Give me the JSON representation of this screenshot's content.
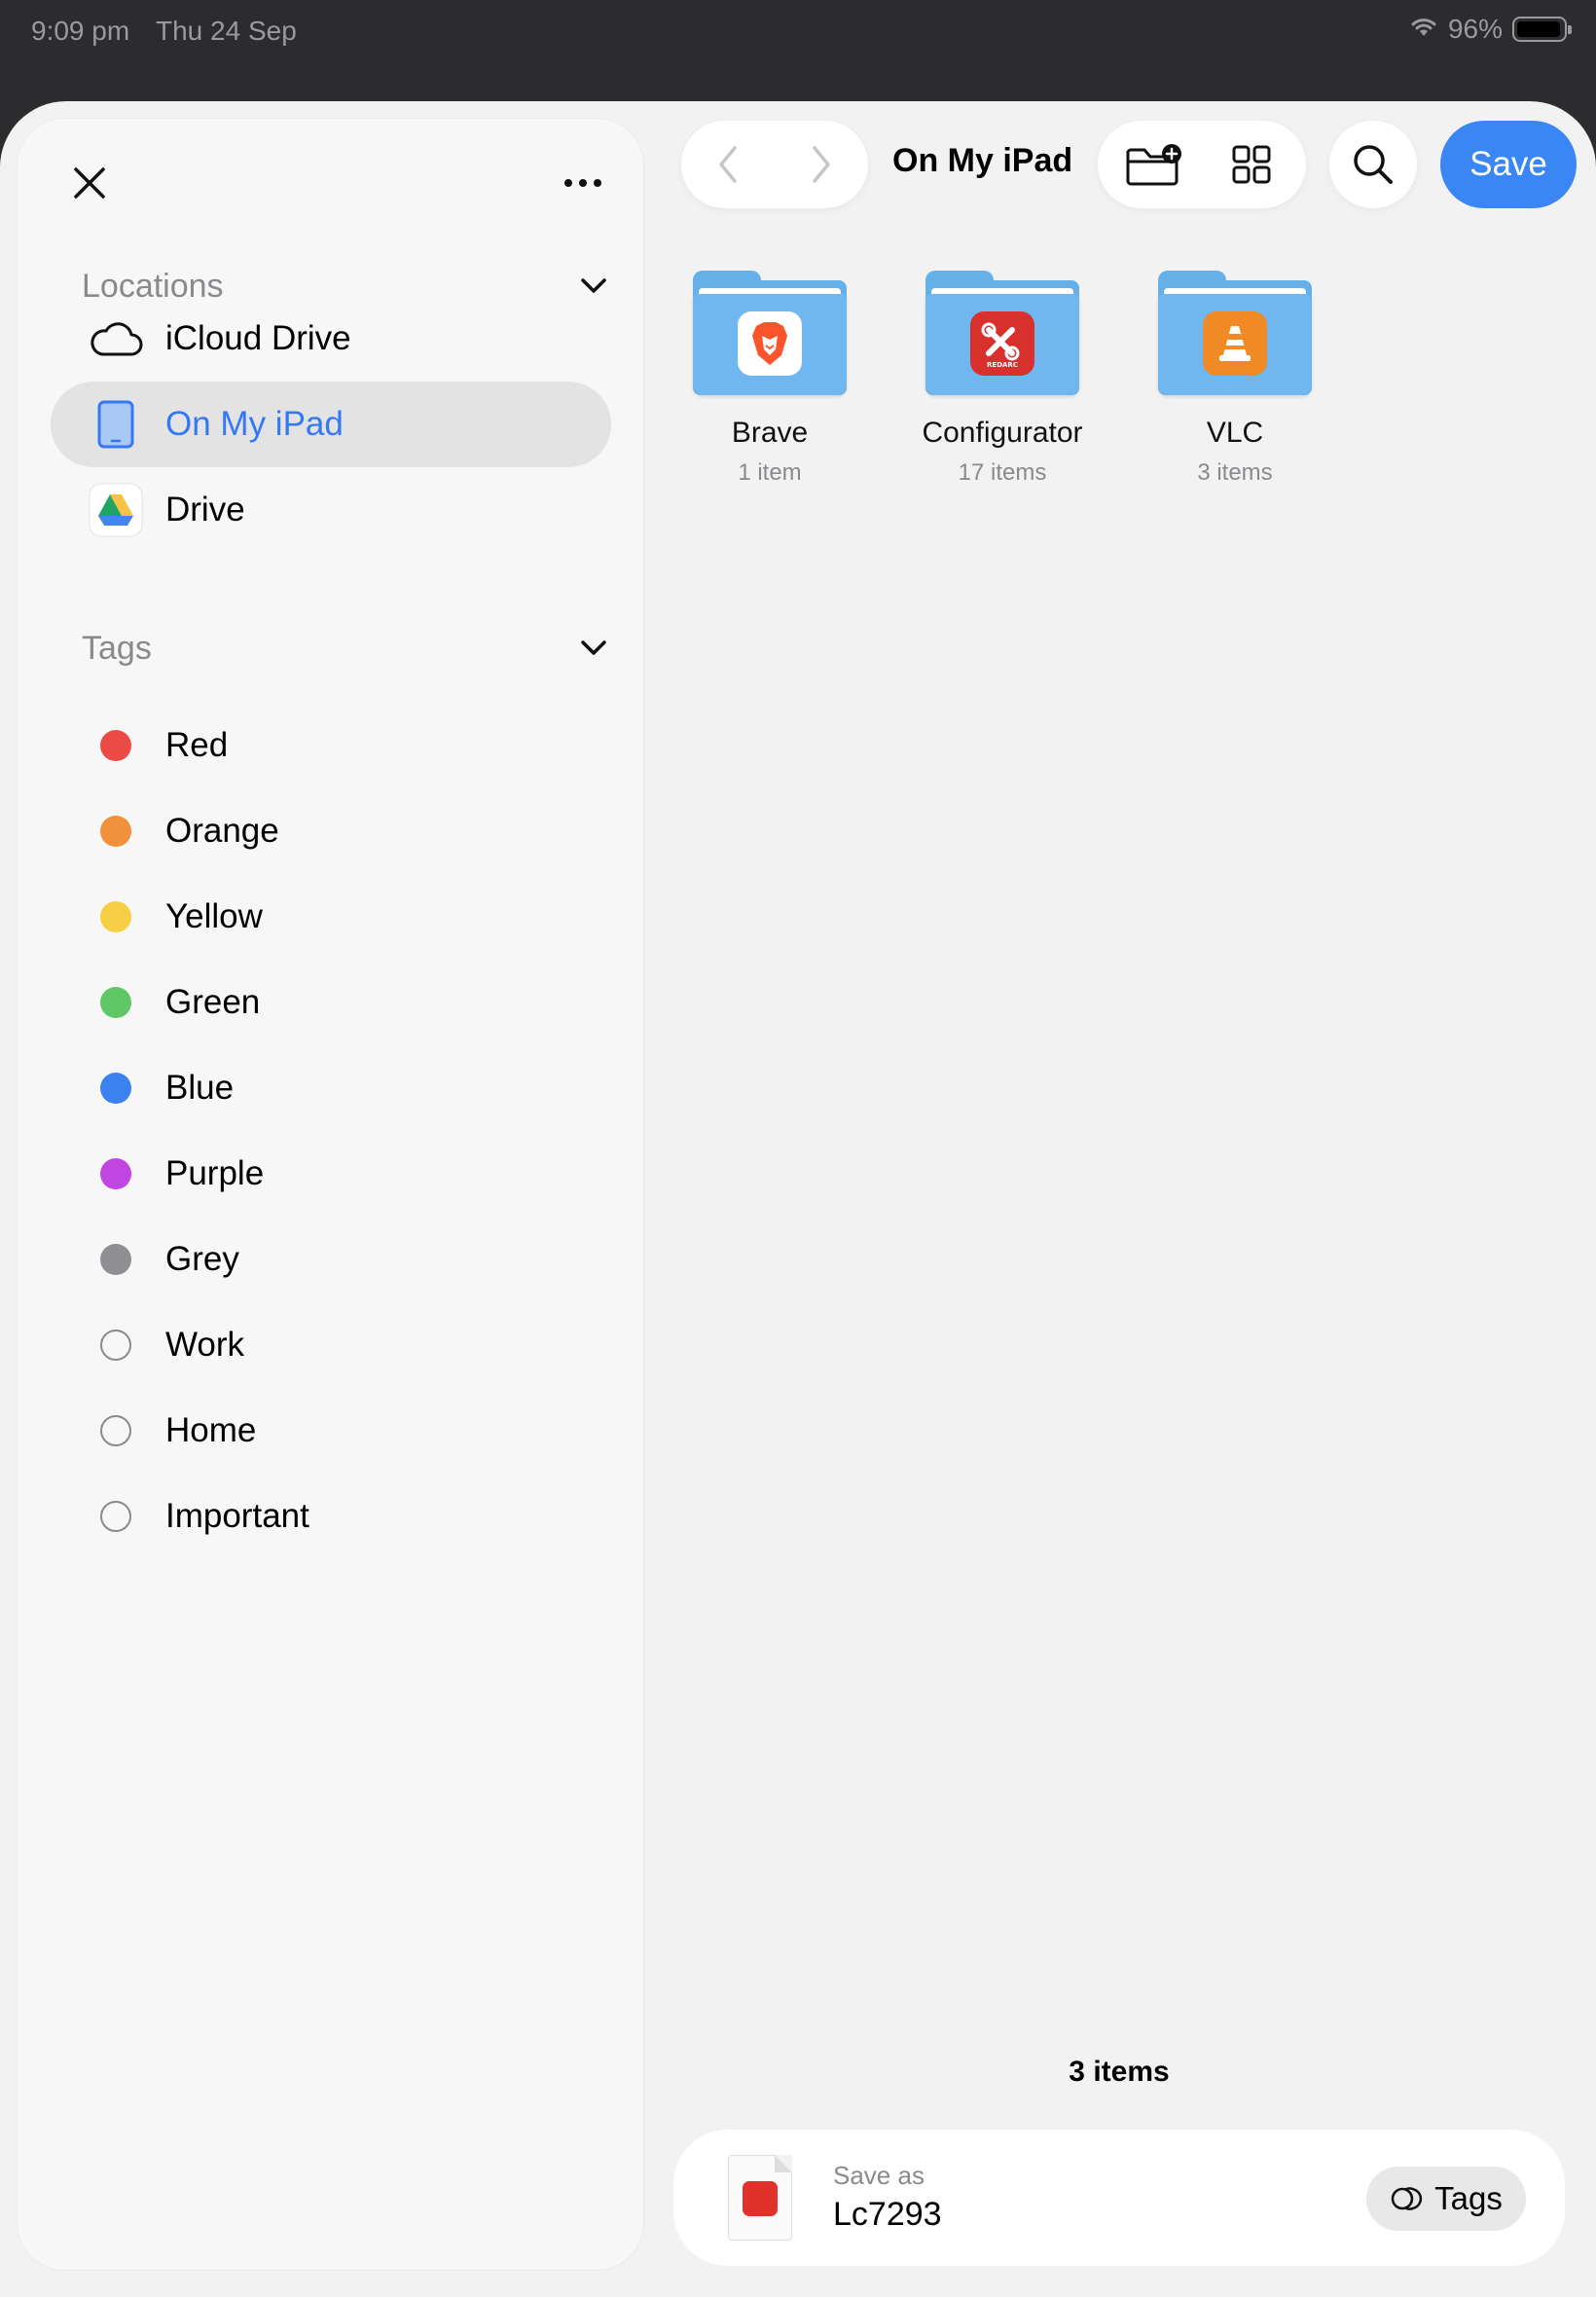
{
  "status_bar": {
    "time": "9:09 pm",
    "date": "Thu 24 Sep",
    "battery": "96%",
    "battery_level": 0.96
  },
  "sidebar": {
    "locations_header": "Locations",
    "locations": [
      {
        "label": "iCloud Drive",
        "icon": "cloud-icon"
      },
      {
        "label": "On My iPad",
        "icon": "ipad-icon",
        "selected": true
      },
      {
        "label": "Drive",
        "icon": "google-drive-icon"
      }
    ],
    "tags_header": "Tags",
    "tags": [
      {
        "label": "Red",
        "color": "#eb4b45"
      },
      {
        "label": "Orange",
        "color": "#f1913d"
      },
      {
        "label": "Yellow",
        "color": "#f6cf45"
      },
      {
        "label": "Green",
        "color": "#5fc766"
      },
      {
        "label": "Blue",
        "color": "#3b82f0"
      },
      {
        "label": "Purple",
        "color": "#c145e1"
      },
      {
        "label": "Grey",
        "color": "#8e8e93"
      },
      {
        "label": "Work",
        "color": ""
      },
      {
        "label": "Home",
        "color": ""
      },
      {
        "label": "Important",
        "color": ""
      }
    ]
  },
  "toolbar": {
    "location_title": "On My iPad",
    "save_label": "Save"
  },
  "folders": [
    {
      "name": "Brave",
      "count": "1 item",
      "badge_color": "#fb542b",
      "icon": "brave-lion-icon"
    },
    {
      "name": "Configurator",
      "count": "17 items",
      "badge_color": "#d8312d",
      "icon": "redarc-configurator-icon",
      "badge_text": "REDARC"
    },
    {
      "name": "VLC",
      "count": "3 items",
      "badge_color": "#f08a24",
      "icon": "vlc-cone-icon"
    }
  ],
  "footer": {
    "items_count": "3 items",
    "save_as_label": "Save as",
    "filename": "Lc7293",
    "tags_label": "Tags"
  },
  "colors": {
    "accent": "#3a86f4",
    "selection_bg": "#e3e3e3"
  }
}
